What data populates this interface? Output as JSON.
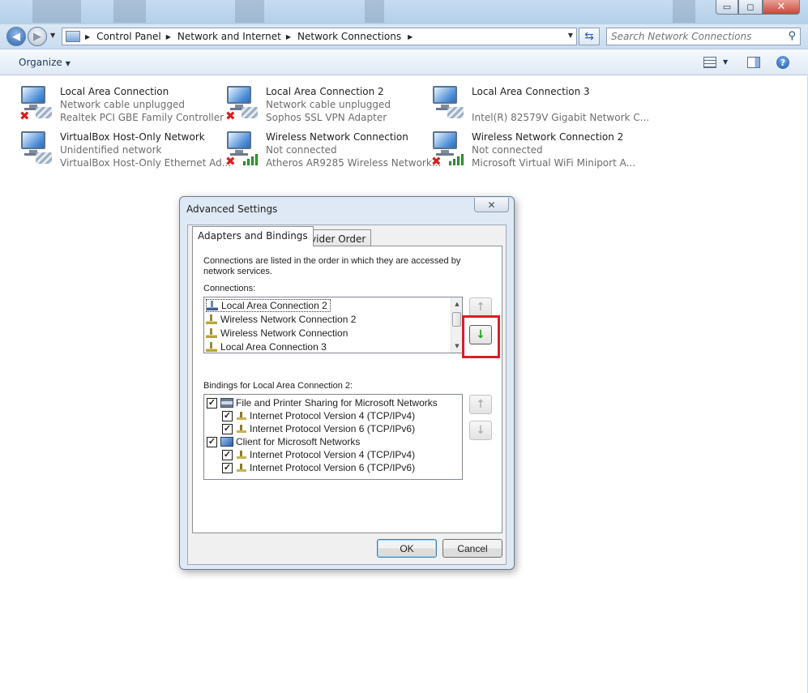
{
  "window": {
    "minimize_glyph": "▭",
    "maximize_glyph": "◻",
    "close_glyph": "✕"
  },
  "nav": {
    "breadcrumb": [
      "Control Panel",
      "Network and Internet",
      "Network Connections"
    ],
    "search_placeholder": "Search Network Connections"
  },
  "toolbar": {
    "organize_label": "Organize"
  },
  "connections": [
    {
      "name": "Local Area Connection",
      "status": "Network cable unplugged",
      "device": "Realtek PCI GBE Family Controller",
      "status_icon": "red-x-icon"
    },
    {
      "name": "Local Area Connection 2",
      "status": "Network cable unplugged",
      "device": "Sophos SSL VPN Adapter",
      "status_icon": "red-x-icon"
    },
    {
      "name": "Local Area Connection 3",
      "status": "",
      "device": "Intel(R) 82579V Gigabit Network C...",
      "status_icon": "none"
    },
    {
      "name": "VirtualBox Host-Only Network",
      "status": "Unidentified network",
      "device": "VirtualBox Host-Only Ethernet Ad...",
      "status_icon": "none"
    },
    {
      "name": "Wireless Network Connection",
      "status": "Not connected",
      "device": "Atheros AR9285 Wireless Network...",
      "status_icon": "red-x-signal-icon"
    },
    {
      "name": "Wireless Network Connection 2",
      "status": "Not connected",
      "device": "Microsoft Virtual WiFi Miniport A...",
      "status_icon": "red-x-signal-icon"
    }
  ],
  "dialog": {
    "title": "Advanced Settings",
    "close_glyph": "✕",
    "tabs": [
      "Adapters and Bindings",
      "Provider Order"
    ],
    "description": "Connections are listed in the order in which they are accessed by network services.",
    "connections_label": "Connections:",
    "connections_list": [
      {
        "label": "Local Area Connection 2",
        "selected": true,
        "icon": "wired"
      },
      {
        "label": "Wireless Network Connection 2",
        "selected": false,
        "icon": "wireless"
      },
      {
        "label": "Wireless Network Connection",
        "selected": false,
        "icon": "wireless"
      },
      {
        "label": "Local Area Connection 3",
        "selected": false,
        "icon": "wireless"
      }
    ],
    "bindings_label": "Bindings for Local Area Connection 2:",
    "bindings": [
      {
        "label": "File and Printer Sharing for Microsoft Networks",
        "level": 0,
        "checked": true,
        "icon": "printer"
      },
      {
        "label": "Internet Protocol Version 4 (TCP/IPv4)",
        "level": 1,
        "checked": true,
        "icon": "proto"
      },
      {
        "label": "Internet Protocol Version 6 (TCP/IPv6)",
        "level": 1,
        "checked": true,
        "icon": "proto"
      },
      {
        "label": "Client for Microsoft Networks",
        "level": 0,
        "checked": true,
        "icon": "client"
      },
      {
        "label": "Internet Protocol Version 4 (TCP/IPv4)",
        "level": 1,
        "checked": true,
        "icon": "proto"
      },
      {
        "label": "Internet Protocol Version 6 (TCP/IPv6)",
        "level": 1,
        "checked": true,
        "icon": "proto"
      }
    ],
    "ok_label": "OK",
    "cancel_label": "Cancel"
  },
  "colors": {
    "highlight_box": "#e01b24",
    "arrow_active": "#22a022",
    "status_error": "#d8201c"
  }
}
